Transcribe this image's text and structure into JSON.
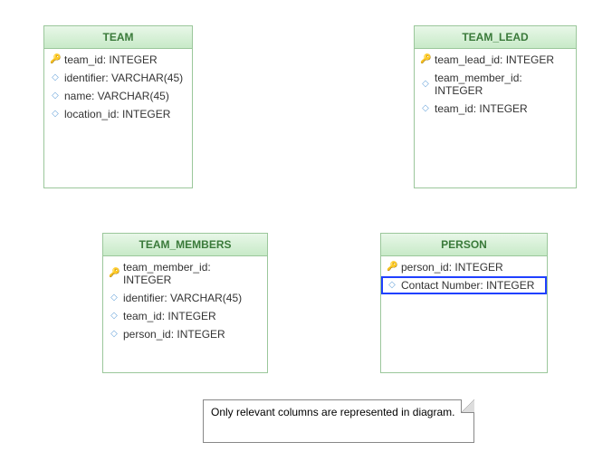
{
  "entities": {
    "team": {
      "title": "TEAM",
      "columns": [
        {
          "kind": "key",
          "label": "team_id: INTEGER"
        },
        {
          "kind": "col",
          "label": "identifier: VARCHAR(45)"
        },
        {
          "kind": "col",
          "label": "name: VARCHAR(45)"
        },
        {
          "kind": "col",
          "label": "location_id: INTEGER"
        }
      ]
    },
    "team_lead": {
      "title": "TEAM_LEAD",
      "columns": [
        {
          "kind": "key",
          "label": "team_lead_id: INTEGER"
        },
        {
          "kind": "col",
          "label": "team_member_id: INTEGER"
        },
        {
          "kind": "col",
          "label": "team_id: INTEGER"
        }
      ]
    },
    "team_members": {
      "title": "TEAM_MEMBERS",
      "columns": [
        {
          "kind": "key",
          "label": "team_member_id: INTEGER"
        },
        {
          "kind": "col",
          "label": "identifier: VARCHAR(45)"
        },
        {
          "kind": "col",
          "label": "team_id: INTEGER"
        },
        {
          "kind": "col",
          "label": "person_id: INTEGER"
        }
      ]
    },
    "person": {
      "title": "PERSON",
      "columns": [
        {
          "kind": "key",
          "label": "person_id: INTEGER"
        },
        {
          "kind": "col",
          "label": "Contact Number: INTEGER",
          "selected": true
        }
      ]
    }
  },
  "note": {
    "text": "Only relevant columns are represented in diagram."
  }
}
